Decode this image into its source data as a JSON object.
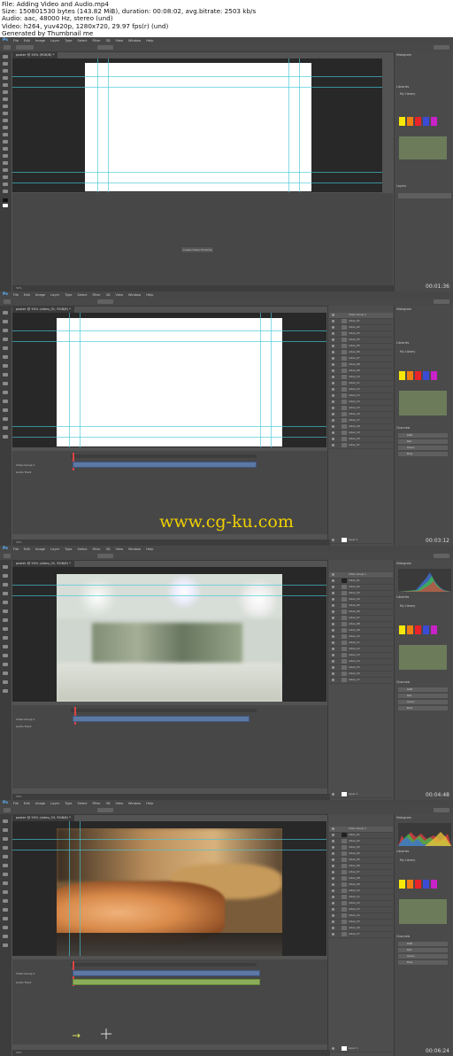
{
  "header": {
    "lines": [
      "File: Adding Video and Audio.mp4",
      "Size: 150801530 bytes (143.82 MiB), duration: 00:08:02, avg.bitrate: 2503 kb/s",
      "Audio: aac, 48000 Hz, stereo (und)",
      "Video: h264, yuv420p, 1280x720, 29.97 fps(r) (und)",
      "Generated by Thumbnail me"
    ]
  },
  "frames": [
    {
      "timestamp": "00:01:36",
      "doc_tab": "poster @ 50% (RGB/8) *",
      "has_layers_panel": false,
      "create_timeline_label": "Create Video Timeline",
      "status_zoom": "50%"
    },
    {
      "timestamp": "00:03:12",
      "doc_tab": "poster @ 50% (video_01, RGB/8) *",
      "has_layers_panel": true,
      "track_labels": [
        "Video Group 1",
        "Audio Track"
      ],
      "status_zoom": "50%"
    },
    {
      "timestamp": "00:04:48",
      "doc_tab": "poster @ 50% (video_02, RGB/8) *",
      "has_layers_panel": true,
      "track_labels": [
        "Video Group 1",
        "Audio Track"
      ],
      "status_zoom": "50%"
    },
    {
      "timestamp": "00:06:24",
      "doc_tab": "poster @ 50% (video_03, RGB/8) *",
      "has_layers_panel": true,
      "track_labels": [
        "Video Group 1",
        "Audio Track"
      ],
      "status_zoom": "50%"
    }
  ],
  "menu": [
    "Ps",
    "File",
    "Edit",
    "Image",
    "Layer",
    "Type",
    "Select",
    "Filter",
    "3D",
    "View",
    "Window",
    "Help"
  ],
  "layers": [
    "Video Group 1",
    "video_01",
    "video_02",
    "video_03",
    "video_04",
    "video_05",
    "video_06",
    "video_07",
    "video_08",
    "video_09",
    "video_10",
    "video_11",
    "video_12",
    "video_13",
    "video_14",
    "video_15",
    "video_16",
    "video_17",
    "video_18",
    "video_19",
    "video_20",
    "video_21",
    "Layer 1"
  ],
  "right_panel": {
    "tabs": [
      "Histogram",
      "Libraries",
      "Adjustments",
      "Channels"
    ],
    "library_name": "My Library",
    "swatch_colors": [
      "#f7e80a",
      "#f07f13",
      "#e8232a",
      "#3b4bd6",
      "#c822c8"
    ],
    "channels": [
      "RGB",
      "Red",
      "Green",
      "Blue"
    ]
  },
  "watermark": "www.cg-ku.com",
  "colors": {
    "ui_bg": "#535353",
    "panel": "#4a4a4a",
    "canvas_bg": "#282828",
    "guide": "#43c7d8",
    "video_track": "#5e78a4",
    "audio_track": "#8bad5a",
    "watermark": "#f0d000"
  }
}
